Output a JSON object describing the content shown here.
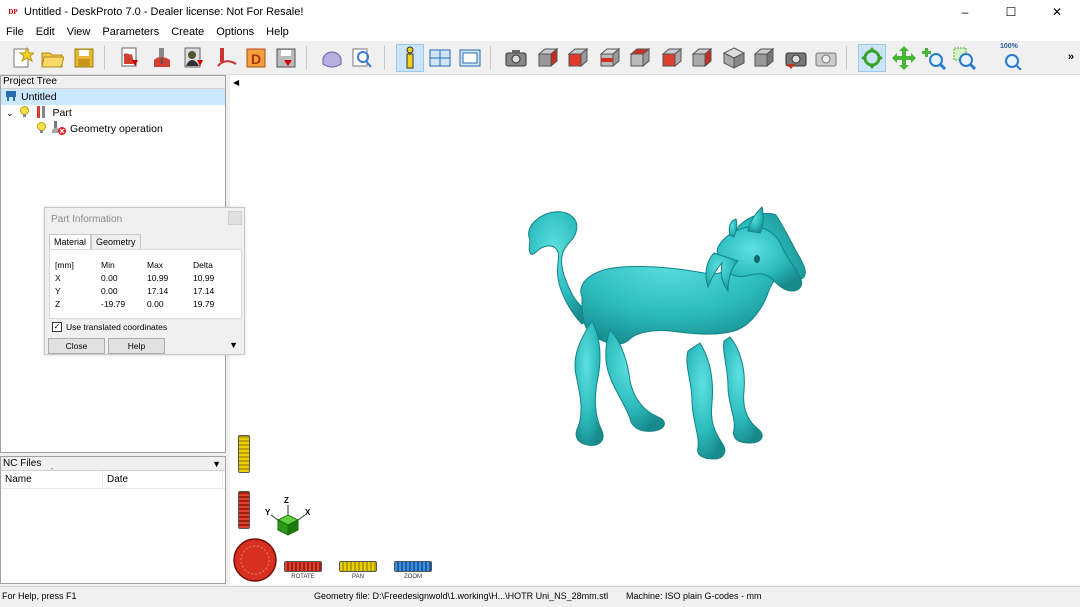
{
  "window": {
    "app_icon": "DP",
    "title": "Untitled - DeskProto 7.0 - Dealer license: Not For Resale!",
    "minimize": "–",
    "maximize": "☐",
    "close": "✕"
  },
  "menu": [
    "File",
    "Edit",
    "View",
    "Parameters",
    "Create",
    "Options",
    "Help"
  ],
  "toolbar": {
    "zoom_label": "100%",
    "more": "»",
    "icons": [
      "new-icon",
      "open-icon",
      "save-icon",
      "import-icon",
      "add-operation-icon",
      "bitmap-icon",
      "vector-icon",
      "relief-icon",
      "save-toolpath-icon",
      "simulate-icon",
      "preview-icon",
      "info-icon",
      "windows-icon",
      "layout-icon",
      "camera-icon",
      "view-front-icon",
      "view-back-icon",
      "view-left-icon",
      "view-right-icon",
      "view-top-icon",
      "view-bottom-icon",
      "view-iso-icon",
      "view-solid-icon",
      "render-icon",
      "screenshot-icon",
      "rotate-icon",
      "pan-icon",
      "zoom-icon",
      "zoom-window-icon",
      "zoom-100-icon"
    ]
  },
  "project_tree": {
    "header": "Project Tree",
    "root": "Untitled",
    "part": "Part",
    "operation": "Geometry operation"
  },
  "nc_files": {
    "header": "NC Files",
    "columns": [
      "Name",
      "Date"
    ]
  },
  "part_info": {
    "title": "Part Information",
    "tabs": [
      "Material",
      "Geometry"
    ],
    "headers": [
      "[mm]",
      "Min",
      "Max",
      "Delta"
    ],
    "rows": [
      [
        "X",
        "0.00",
        "10.99",
        "10.99"
      ],
      [
        "Y",
        "0.00",
        "17.14",
        "17.14"
      ],
      [
        "Z",
        "-19.79",
        "0.00",
        "19.79"
      ]
    ],
    "checkbox_label": "Use translated coordinates",
    "checkbox_checked": true,
    "close_button": "Close",
    "help_button": "Help"
  },
  "viewport": {
    "axes": {
      "x": "X",
      "y": "Y",
      "z": "Z"
    },
    "nav_labels": [
      "ROTATE",
      "PAN",
      "ZOOM"
    ],
    "model_color": "#2cbcbe"
  },
  "status": {
    "help": "For Help, press F1",
    "geometry": "Geometry file: D:\\Freedesignwold\\1.working\\H...\\HOTR Uni_NS_28mm.stl",
    "machine": "Machine: ISO plain G-codes - mm"
  }
}
